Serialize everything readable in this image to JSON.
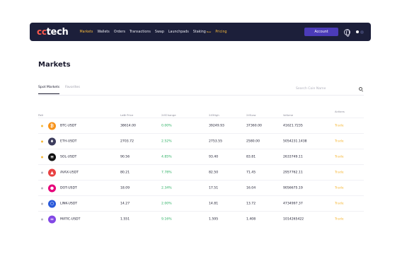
{
  "brand": {
    "prefix": "cc",
    "name": "tech"
  },
  "nav": {
    "items": [
      {
        "label": "Markets",
        "active": true
      },
      {
        "label": "Wallets"
      },
      {
        "label": "Orders"
      },
      {
        "label": "Transactions"
      },
      {
        "label": "Swap"
      },
      {
        "label": "Launchpads"
      },
      {
        "label": "Staking",
        "badge": "New"
      },
      {
        "label": "Pricing",
        "highlight": true
      }
    ],
    "account_label": "Account"
  },
  "page": {
    "title": "Markets"
  },
  "tabs": [
    {
      "label": "Spot Markets",
      "active": true
    },
    {
      "label": "Favorites"
    }
  ],
  "search": {
    "placeholder": "Search Coin Name"
  },
  "table": {
    "headers": {
      "pair": "Pair",
      "last_price": "Last Price",
      "change": "24 Change",
      "high": "24 High",
      "low": "24 Low",
      "volume": "Volume",
      "actions": "Actions"
    },
    "rows": [
      {
        "fav": true,
        "icon": "bitcoin-icon",
        "color": "#f7931a",
        "glyph": "₿",
        "pair": "BTC-USDT",
        "price": "38614.00",
        "change": "0.00%",
        "high": "39249.93",
        "low": "37360.00",
        "volume": "41621.7235",
        "action": "Trade"
      },
      {
        "fav": true,
        "icon": "ethereum-icon",
        "color": "#3c3c5d",
        "glyph": "♦",
        "pair": "ETH-USDT",
        "price": "2703.72",
        "change": "2.52%",
        "high": "2753.55",
        "low": "2580.00",
        "volume": "5054231.1438",
        "action": "Trade"
      },
      {
        "fav": true,
        "icon": "solana-icon",
        "color": "#111111",
        "glyph": "≡",
        "pair": "SOL-USDT",
        "price": "90.56",
        "change": "4.85%",
        "high": "93.40",
        "low": "83.81",
        "volume": "2633749.11",
        "action": "Trade"
      },
      {
        "fav": false,
        "icon": "avalanche-icon",
        "color": "#e84142",
        "glyph": "▲",
        "pair": "AVAX-USDT",
        "price": "80.21",
        "change": "7.78%",
        "high": "82.50",
        "low": "71.45",
        "volume": "2957762.11",
        "action": "Trade"
      },
      {
        "fav": false,
        "icon": "polkadot-icon",
        "color": "#e6007a",
        "glyph": "●",
        "pair": "DOT-USDT",
        "price": "18.09",
        "change": "2.34%",
        "high": "17.51",
        "low": "16.04",
        "volume": "9056675.19",
        "action": "Trade"
      },
      {
        "fav": false,
        "icon": "chainlink-icon",
        "color": "#2a5ada",
        "glyph": "⬡",
        "pair": "LINK-USDT",
        "price": "14.27",
        "change": "2.00%",
        "high": "14.81",
        "low": "13.72",
        "volume": "4734997.37",
        "action": "Trade"
      },
      {
        "fav": false,
        "icon": "polygon-icon",
        "color": "#8247e5",
        "glyph": "∞",
        "pair": "MATIC-USDT",
        "price": "1.551",
        "change": "9.16%",
        "high": "1.595",
        "low": "1.408",
        "volume": "1014265422",
        "action": "Trade"
      }
    ]
  }
}
